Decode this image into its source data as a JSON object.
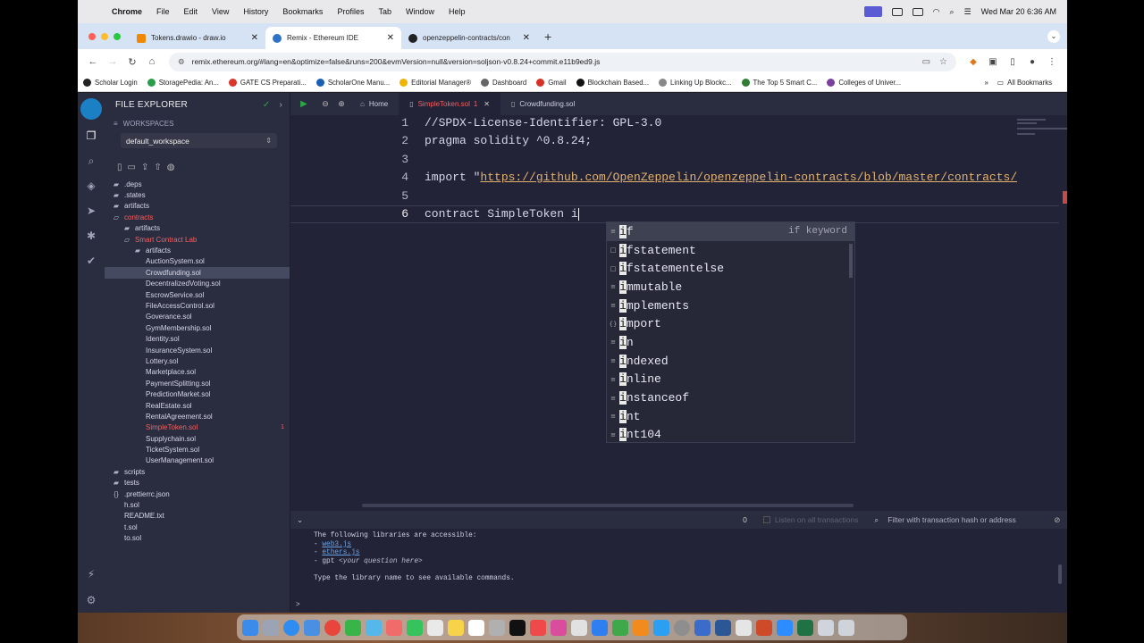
{
  "menubar": {
    "items": [
      "Chrome",
      "File",
      "Edit",
      "View",
      "History",
      "Bookmarks",
      "Profiles",
      "Tab",
      "Window",
      "Help"
    ],
    "datetime": "Wed Mar 20  6:36 AM"
  },
  "browser": {
    "tabs": [
      {
        "title": "Tokens.drawio - draw.io",
        "color": "#f08705",
        "active": false
      },
      {
        "title": "Remix - Ethereum IDE",
        "color": "#2e73c8",
        "active": true
      },
      {
        "title": "openzeppelin-contracts/con",
        "color": "#222222",
        "active": false
      }
    ],
    "url": "remix.ethereum.org/#lang=en&optimize=false&runs=200&evmVersion=null&version=soljson-v0.8.24+commit.e11b9ed9.js",
    "bookmarks": [
      {
        "label": "Scholar Login",
        "color": "#222222"
      },
      {
        "label": "StoragePedia: An...",
        "color": "#2a9d4a"
      },
      {
        "label": "GATE CS Preparati...",
        "color": "#d9352b"
      },
      {
        "label": "ScholarOne Manu...",
        "color": "#1a5fb4"
      },
      {
        "label": "Editorial Manager®",
        "color": "#f0b400"
      },
      {
        "label": "Dashboard",
        "color": "#666666"
      },
      {
        "label": "Gmail",
        "color": "#d93025"
      },
      {
        "label": "Blockchain Based...",
        "color": "#111111"
      },
      {
        "label": "Linking Up Blockc...",
        "color": "#888888"
      },
      {
        "label": "The Top 5 Smart C...",
        "color": "#2e7d32"
      },
      {
        "label": "Colleges of Univer...",
        "color": "#7b3fa0"
      }
    ],
    "all_bookmarks": "All Bookmarks"
  },
  "explorer": {
    "title": "FILE EXPLORER",
    "workspaces_label": "WORKSPACES",
    "workspace": "default_workspace",
    "tree": [
      {
        "label": ".deps",
        "indent": 0,
        "type": "folder"
      },
      {
        "label": ".states",
        "indent": 0,
        "type": "folder"
      },
      {
        "label": "artifacts",
        "indent": 0,
        "type": "folder"
      },
      {
        "label": "contracts",
        "indent": 0,
        "type": "folder-open",
        "active": true
      },
      {
        "label": "artifacts",
        "indent": 1,
        "type": "folder"
      },
      {
        "label": "Smart Contract Lab",
        "indent": 1,
        "type": "folder-open",
        "active": true
      },
      {
        "label": "artifacts",
        "indent": 2,
        "type": "folder"
      },
      {
        "label": "AuctionSystem.sol",
        "indent": 2,
        "type": "file"
      },
      {
        "label": "Crowdfunding.sol",
        "indent": 2,
        "type": "file",
        "selected": true
      },
      {
        "label": "DecentralizedVoting.sol",
        "indent": 2,
        "type": "file"
      },
      {
        "label": "EscrowService.sol",
        "indent": 2,
        "type": "file"
      },
      {
        "label": "FileAccessControl.sol",
        "indent": 2,
        "type": "file"
      },
      {
        "label": "Goverance.sol",
        "indent": 2,
        "type": "file"
      },
      {
        "label": "GymMembership.sol",
        "indent": 2,
        "type": "file"
      },
      {
        "label": "Identity.sol",
        "indent": 2,
        "type": "file"
      },
      {
        "label": "InsuranceSystem.sol",
        "indent": 2,
        "type": "file"
      },
      {
        "label": "Lottery.sol",
        "indent": 2,
        "type": "file"
      },
      {
        "label": "Marketplace.sol",
        "indent": 2,
        "type": "file"
      },
      {
        "label": "PaymentSplitting.sol",
        "indent": 2,
        "type": "file"
      },
      {
        "label": "PredictionMarket.sol",
        "indent": 2,
        "type": "file"
      },
      {
        "label": "RealEstate.sol",
        "indent": 2,
        "type": "file"
      },
      {
        "label": "RentalAgreement.sol",
        "indent": 2,
        "type": "file"
      },
      {
        "label": "SimpleToken.sol",
        "indent": 2,
        "type": "file",
        "active": true,
        "badge": "1"
      },
      {
        "label": "Supplychain.sol",
        "indent": 2,
        "type": "file"
      },
      {
        "label": "TicketSystem.sol",
        "indent": 2,
        "type": "file"
      },
      {
        "label": "UserManagement.sol",
        "indent": 2,
        "type": "file"
      },
      {
        "label": "scripts",
        "indent": 0,
        "type": "folder"
      },
      {
        "label": "tests",
        "indent": 0,
        "type": "folder"
      },
      {
        "label": ".prettierrc.json",
        "indent": 0,
        "type": "json"
      },
      {
        "label": "h.sol",
        "indent": 0,
        "type": "file"
      },
      {
        "label": "README.txt",
        "indent": 0,
        "type": "file"
      },
      {
        "label": "t.sol",
        "indent": 0,
        "type": "file"
      },
      {
        "label": "to.sol",
        "indent": 0,
        "type": "file"
      }
    ]
  },
  "editor": {
    "tabs": [
      {
        "label": "Home",
        "active": false
      },
      {
        "label": "SimpleToken.sol",
        "active": true,
        "badge": "1"
      },
      {
        "label": "Crowdfunding.sol",
        "active": false
      }
    ],
    "lines": [
      {
        "num": "1",
        "text": "//SPDX-License-Identifier: GPL-3.0",
        "kind": "comment"
      },
      {
        "num": "2",
        "text": "pragma solidity ^0.8.24;",
        "kind": "plain"
      },
      {
        "num": "3",
        "text": "",
        "kind": "plain"
      },
      {
        "num": "4",
        "prefix": "import \"",
        "string": "https://github.com/OpenZeppelin/openzeppelin-contracts/blob/master/contracts/",
        "kind": "import"
      },
      {
        "num": "5",
        "text": "",
        "kind": "plain"
      },
      {
        "num": "6",
        "text": "contract SimpleToken i",
        "kind": "current"
      }
    ],
    "suggestions": [
      {
        "match": "i",
        "rest": "f",
        "icon": "≡",
        "detail": "if keyword"
      },
      {
        "match": "i",
        "rest": "fstatement",
        "icon": "□",
        "detail": ""
      },
      {
        "match": "i",
        "rest": "fstatementelse",
        "icon": "□",
        "detail": ""
      },
      {
        "match": "i",
        "rest": "mmutable",
        "icon": "≡",
        "detail": ""
      },
      {
        "match": "i",
        "rest": "mplements",
        "icon": "≡",
        "detail": ""
      },
      {
        "match": "i",
        "rest": "mport",
        "icon": "{}",
        "detail": ""
      },
      {
        "match": "i",
        "rest": "n",
        "icon": "≡",
        "detail": ""
      },
      {
        "match": "i",
        "rest": "ndexed",
        "icon": "≡",
        "detail": ""
      },
      {
        "match": "i",
        "rest": "nline",
        "icon": "≡",
        "detail": ""
      },
      {
        "match": "i",
        "rest": "nstanceof",
        "icon": "≡",
        "detail": ""
      },
      {
        "match": "i",
        "rest": "nt",
        "icon": "≡",
        "detail": ""
      },
      {
        "match": "i",
        "rest": "nt104",
        "icon": "≡",
        "detail": ""
      }
    ]
  },
  "terminal": {
    "count": "0",
    "listen_label": "Listen on all transactions",
    "filter_placeholder": "Filter with transaction hash or address",
    "intro": "The following libraries are accessible:",
    "libs": [
      "web3.js",
      "ethers.js"
    ],
    "gpt": "gpt",
    "gpt_hint": "<your question here>",
    "hint": "Type the library name to see available commands.",
    "prompt": ">"
  }
}
